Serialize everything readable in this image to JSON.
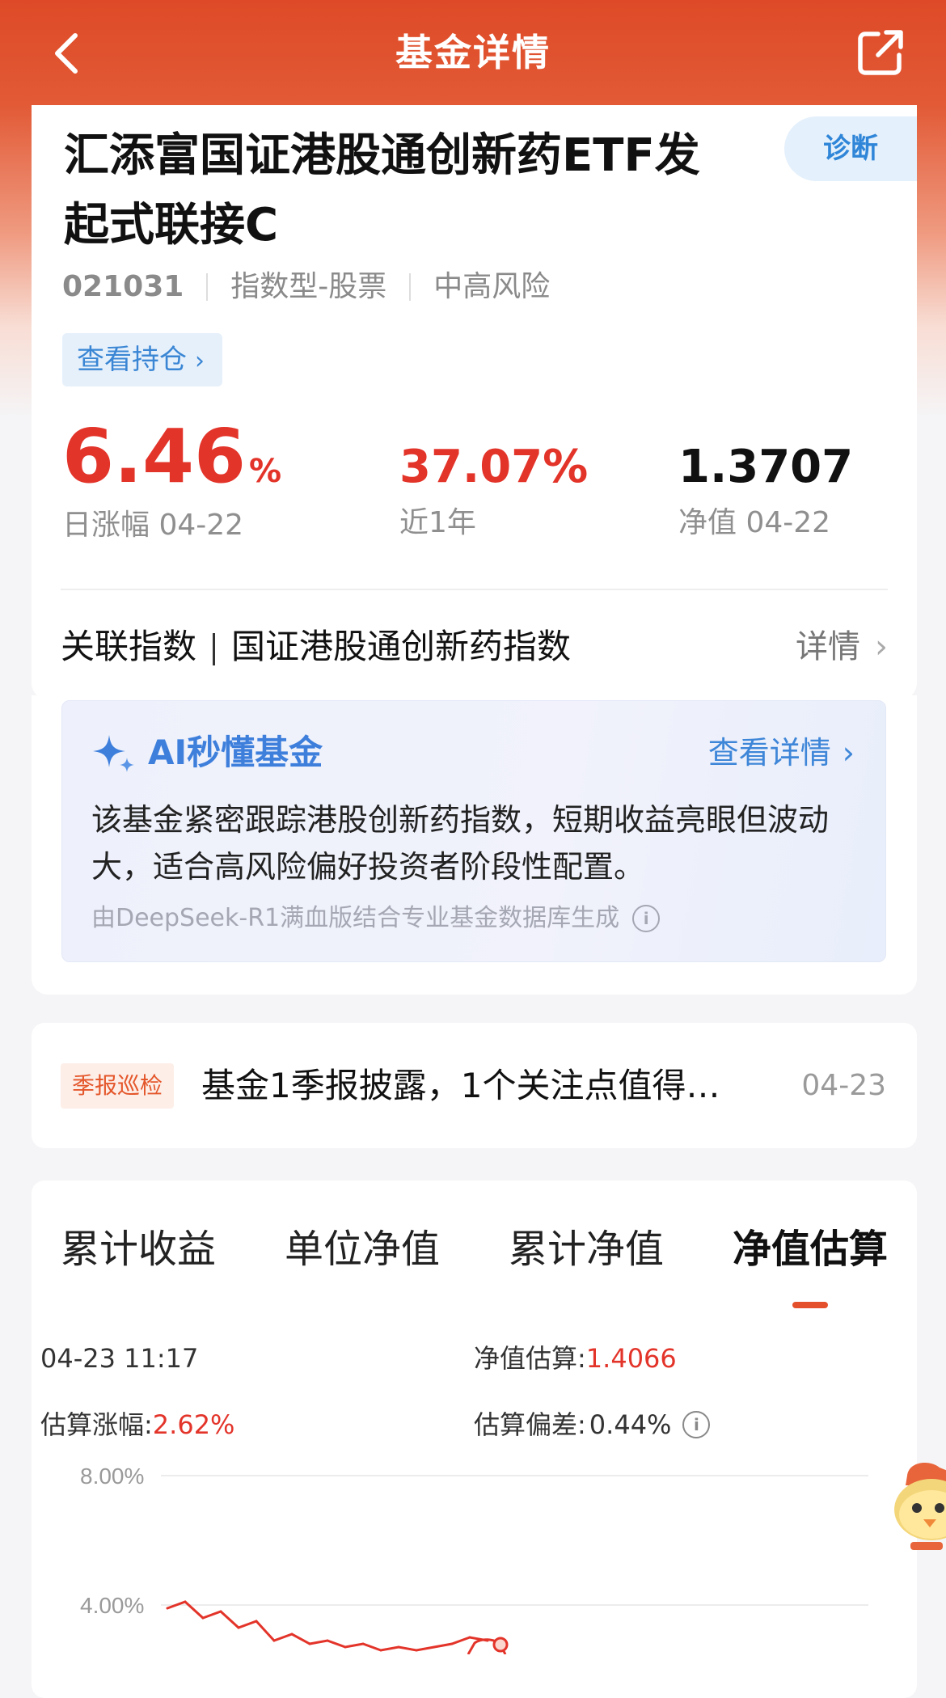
{
  "header": {
    "title": "基金详情",
    "back_icon": "chevron-left-icon",
    "share_icon": "share-icon"
  },
  "fund": {
    "name_line1": "汇添富国证港股通创新药ETF发",
    "name_line2": "起式联接C",
    "diagnose_label": "诊断",
    "code": "021031",
    "type": "指数型-股票",
    "risk": "中高风险",
    "holdings_label": "查看持仓"
  },
  "stats": {
    "daily_change_value": "6.46",
    "daily_change_unit": "%",
    "daily_change_label": "日涨幅 04-22",
    "year_return_value": "37.07%",
    "year_return_label": "近1年",
    "nav_value": "1.3707",
    "nav_label": "净值 04-22"
  },
  "related_index": {
    "label": "关联指数",
    "name": "国证港股通创新药指数",
    "more": "详情"
  },
  "ai": {
    "title": "AI秒懂基金",
    "more": "查看详情",
    "text": "该基金紧密跟踪港股创新药指数，短期收益亮眼但波动大，适合高风险偏好投资者阶段性配置。",
    "source": "由DeepSeek-R1满血版结合专业基金数据库生成"
  },
  "report": {
    "tag": "季报巡检",
    "text": "基金1季报披露，1个关注点值得…",
    "date": "04-23"
  },
  "tabs": [
    "累计收益",
    "单位净值",
    "累计净值",
    "净值估算"
  ],
  "active_tab": 3,
  "estimate": {
    "time": "04-23 11:17",
    "nav_est_label": "净值估算:",
    "nav_est_value": "1.4066",
    "change_label": "估算涨幅:",
    "change_value": "2.62%",
    "deviation_label": "估算偏差:",
    "deviation_value": "0.44%"
  },
  "colors": {
    "header_red": "#de4a27",
    "rise_red": "#e3342a",
    "link_blue": "#3e86d8",
    "tab_underline": "#e4502b"
  },
  "chart_data": {
    "type": "line",
    "y_tick_labels": [
      "8.00%",
      "4.00%"
    ],
    "ylim": [
      0,
      8
    ],
    "x": [
      0,
      1,
      2,
      3,
      4,
      5,
      6,
      7,
      8,
      9,
      10,
      11,
      12,
      13,
      14,
      15,
      16,
      17,
      18
    ],
    "values": [
      3.9,
      4.1,
      3.6,
      3.8,
      3.3,
      3.5,
      2.9,
      3.1,
      2.8,
      2.9,
      2.7,
      2.8,
      2.6,
      2.7,
      2.6,
      2.7,
      2.8,
      3.0,
      2.9
    ],
    "grid": true
  }
}
